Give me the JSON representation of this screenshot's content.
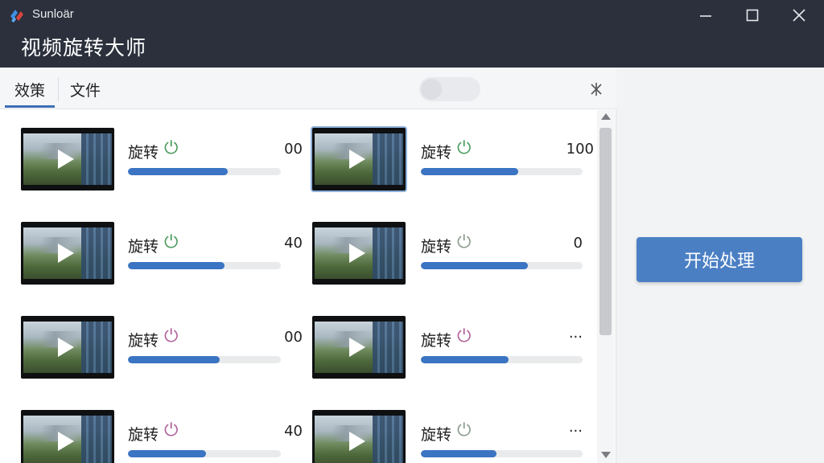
{
  "window": {
    "app_name": "Sunloär",
    "title": "视频旋转大师",
    "minimize_icon": "minimize-icon",
    "maximize_icon": "maximize-icon",
    "close_icon": "close-icon"
  },
  "tabs": [
    {
      "label": "效策",
      "active": true
    },
    {
      "label": "文件",
      "active": false
    }
  ],
  "toolbar": {
    "toggle_on": false,
    "pin_icon": "pin-icon"
  },
  "items": [
    {
      "label": "旋转",
      "icon_color": "#4a9a5c",
      "value": "00",
      "progress": 0.65,
      "selected": false
    },
    {
      "label": "旋转",
      "icon_color": "#4a9a5c",
      "value": "100",
      "progress": 0.6,
      "selected": true
    },
    {
      "label": "旋转",
      "icon_color": "#4a9a5c",
      "value": "40",
      "progress": 0.63,
      "selected": false
    },
    {
      "label": "旋转",
      "icon_color": "#8a9a8c",
      "value": "0",
      "progress": 0.66,
      "selected": false
    },
    {
      "label": "旋转",
      "icon_color": "#b0609a",
      "value": "00",
      "progress": 0.6,
      "selected": false
    },
    {
      "label": "旋转",
      "icon_color": "#b0609a",
      "value": "···",
      "progress": 0.54,
      "selected": false
    },
    {
      "label": "旋转",
      "icon_color": "#b0609a",
      "value": "40",
      "progress": 0.51,
      "selected": false
    },
    {
      "label": "旋转",
      "icon_color": "#8a9a8c",
      "value": "···",
      "progress": 0.47,
      "selected": false
    }
  ],
  "actions": {
    "start_label": "开始处理"
  },
  "colors": {
    "titlebar": "#2b303c",
    "accent": "#3a74c2",
    "button": "#4b7fc4"
  }
}
